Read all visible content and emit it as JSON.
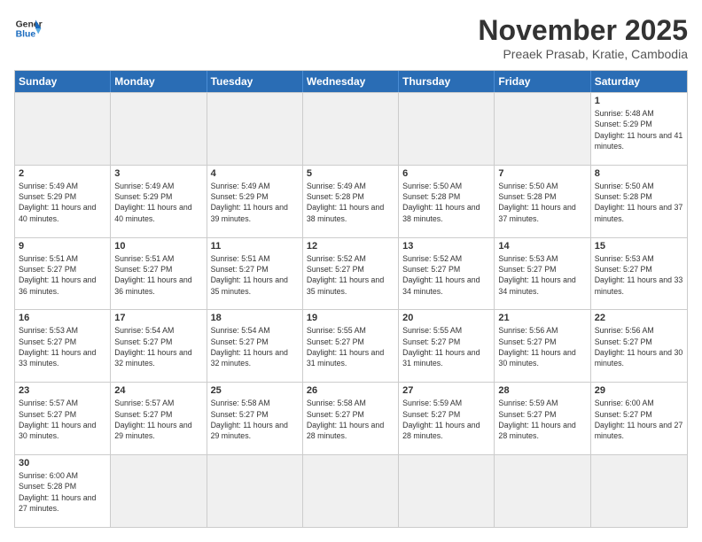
{
  "header": {
    "logo_general": "General",
    "logo_blue": "Blue",
    "month_title": "November 2025",
    "subtitle": "Preaek Prasab, Kratie, Cambodia"
  },
  "days_of_week": [
    "Sunday",
    "Monday",
    "Tuesday",
    "Wednesday",
    "Thursday",
    "Friday",
    "Saturday"
  ],
  "weeks": [
    [
      {
        "day": "",
        "empty": true
      },
      {
        "day": "",
        "empty": true
      },
      {
        "day": "",
        "empty": true
      },
      {
        "day": "",
        "empty": true
      },
      {
        "day": "",
        "empty": true
      },
      {
        "day": "",
        "empty": true
      },
      {
        "day": "1",
        "sunrise": "5:48 AM",
        "sunset": "5:29 PM",
        "daylight": "11 hours and 41 minutes."
      }
    ],
    [
      {
        "day": "2",
        "sunrise": "5:49 AM",
        "sunset": "5:29 PM",
        "daylight": "11 hours and 40 minutes."
      },
      {
        "day": "3",
        "sunrise": "5:49 AM",
        "sunset": "5:29 PM",
        "daylight": "11 hours and 40 minutes."
      },
      {
        "day": "4",
        "sunrise": "5:49 AM",
        "sunset": "5:29 PM",
        "daylight": "11 hours and 39 minutes."
      },
      {
        "day": "5",
        "sunrise": "5:49 AM",
        "sunset": "5:28 PM",
        "daylight": "11 hours and 38 minutes."
      },
      {
        "day": "6",
        "sunrise": "5:50 AM",
        "sunset": "5:28 PM",
        "daylight": "11 hours and 38 minutes."
      },
      {
        "day": "7",
        "sunrise": "5:50 AM",
        "sunset": "5:28 PM",
        "daylight": "11 hours and 37 minutes."
      },
      {
        "day": "8",
        "sunrise": "5:50 AM",
        "sunset": "5:28 PM",
        "daylight": "11 hours and 37 minutes."
      }
    ],
    [
      {
        "day": "9",
        "sunrise": "5:51 AM",
        "sunset": "5:27 PM",
        "daylight": "11 hours and 36 minutes."
      },
      {
        "day": "10",
        "sunrise": "5:51 AM",
        "sunset": "5:27 PM",
        "daylight": "11 hours and 36 minutes."
      },
      {
        "day": "11",
        "sunrise": "5:51 AM",
        "sunset": "5:27 PM",
        "daylight": "11 hours and 35 minutes."
      },
      {
        "day": "12",
        "sunrise": "5:52 AM",
        "sunset": "5:27 PM",
        "daylight": "11 hours and 35 minutes."
      },
      {
        "day": "13",
        "sunrise": "5:52 AM",
        "sunset": "5:27 PM",
        "daylight": "11 hours and 34 minutes."
      },
      {
        "day": "14",
        "sunrise": "5:53 AM",
        "sunset": "5:27 PM",
        "daylight": "11 hours and 34 minutes."
      },
      {
        "day": "15",
        "sunrise": "5:53 AM",
        "sunset": "5:27 PM",
        "daylight": "11 hours and 33 minutes."
      }
    ],
    [
      {
        "day": "16",
        "sunrise": "5:53 AM",
        "sunset": "5:27 PM",
        "daylight": "11 hours and 33 minutes."
      },
      {
        "day": "17",
        "sunrise": "5:54 AM",
        "sunset": "5:27 PM",
        "daylight": "11 hours and 32 minutes."
      },
      {
        "day": "18",
        "sunrise": "5:54 AM",
        "sunset": "5:27 PM",
        "daylight": "11 hours and 32 minutes."
      },
      {
        "day": "19",
        "sunrise": "5:55 AM",
        "sunset": "5:27 PM",
        "daylight": "11 hours and 31 minutes."
      },
      {
        "day": "20",
        "sunrise": "5:55 AM",
        "sunset": "5:27 PM",
        "daylight": "11 hours and 31 minutes."
      },
      {
        "day": "21",
        "sunrise": "5:56 AM",
        "sunset": "5:27 PM",
        "daylight": "11 hours and 30 minutes."
      },
      {
        "day": "22",
        "sunrise": "5:56 AM",
        "sunset": "5:27 PM",
        "daylight": "11 hours and 30 minutes."
      }
    ],
    [
      {
        "day": "23",
        "sunrise": "5:57 AM",
        "sunset": "5:27 PM",
        "daylight": "11 hours and 30 minutes."
      },
      {
        "day": "24",
        "sunrise": "5:57 AM",
        "sunset": "5:27 PM",
        "daylight": "11 hours and 29 minutes."
      },
      {
        "day": "25",
        "sunrise": "5:58 AM",
        "sunset": "5:27 PM",
        "daylight": "11 hours and 29 minutes."
      },
      {
        "day": "26",
        "sunrise": "5:58 AM",
        "sunset": "5:27 PM",
        "daylight": "11 hours and 28 minutes."
      },
      {
        "day": "27",
        "sunrise": "5:59 AM",
        "sunset": "5:27 PM",
        "daylight": "11 hours and 28 minutes."
      },
      {
        "day": "28",
        "sunrise": "5:59 AM",
        "sunset": "5:27 PM",
        "daylight": "11 hours and 28 minutes."
      },
      {
        "day": "29",
        "sunrise": "6:00 AM",
        "sunset": "5:27 PM",
        "daylight": "11 hours and 27 minutes."
      }
    ],
    [
      {
        "day": "30",
        "sunrise": "6:00 AM",
        "sunset": "5:28 PM",
        "daylight": "11 hours and 27 minutes."
      },
      {
        "day": "",
        "empty": true
      },
      {
        "day": "",
        "empty": true
      },
      {
        "day": "",
        "empty": true
      },
      {
        "day": "",
        "empty": true
      },
      {
        "day": "",
        "empty": true
      },
      {
        "day": "",
        "empty": true
      }
    ]
  ],
  "labels": {
    "sunrise_prefix": "Sunrise: ",
    "sunset_prefix": "Sunset: ",
    "daylight_prefix": "Daylight: "
  }
}
